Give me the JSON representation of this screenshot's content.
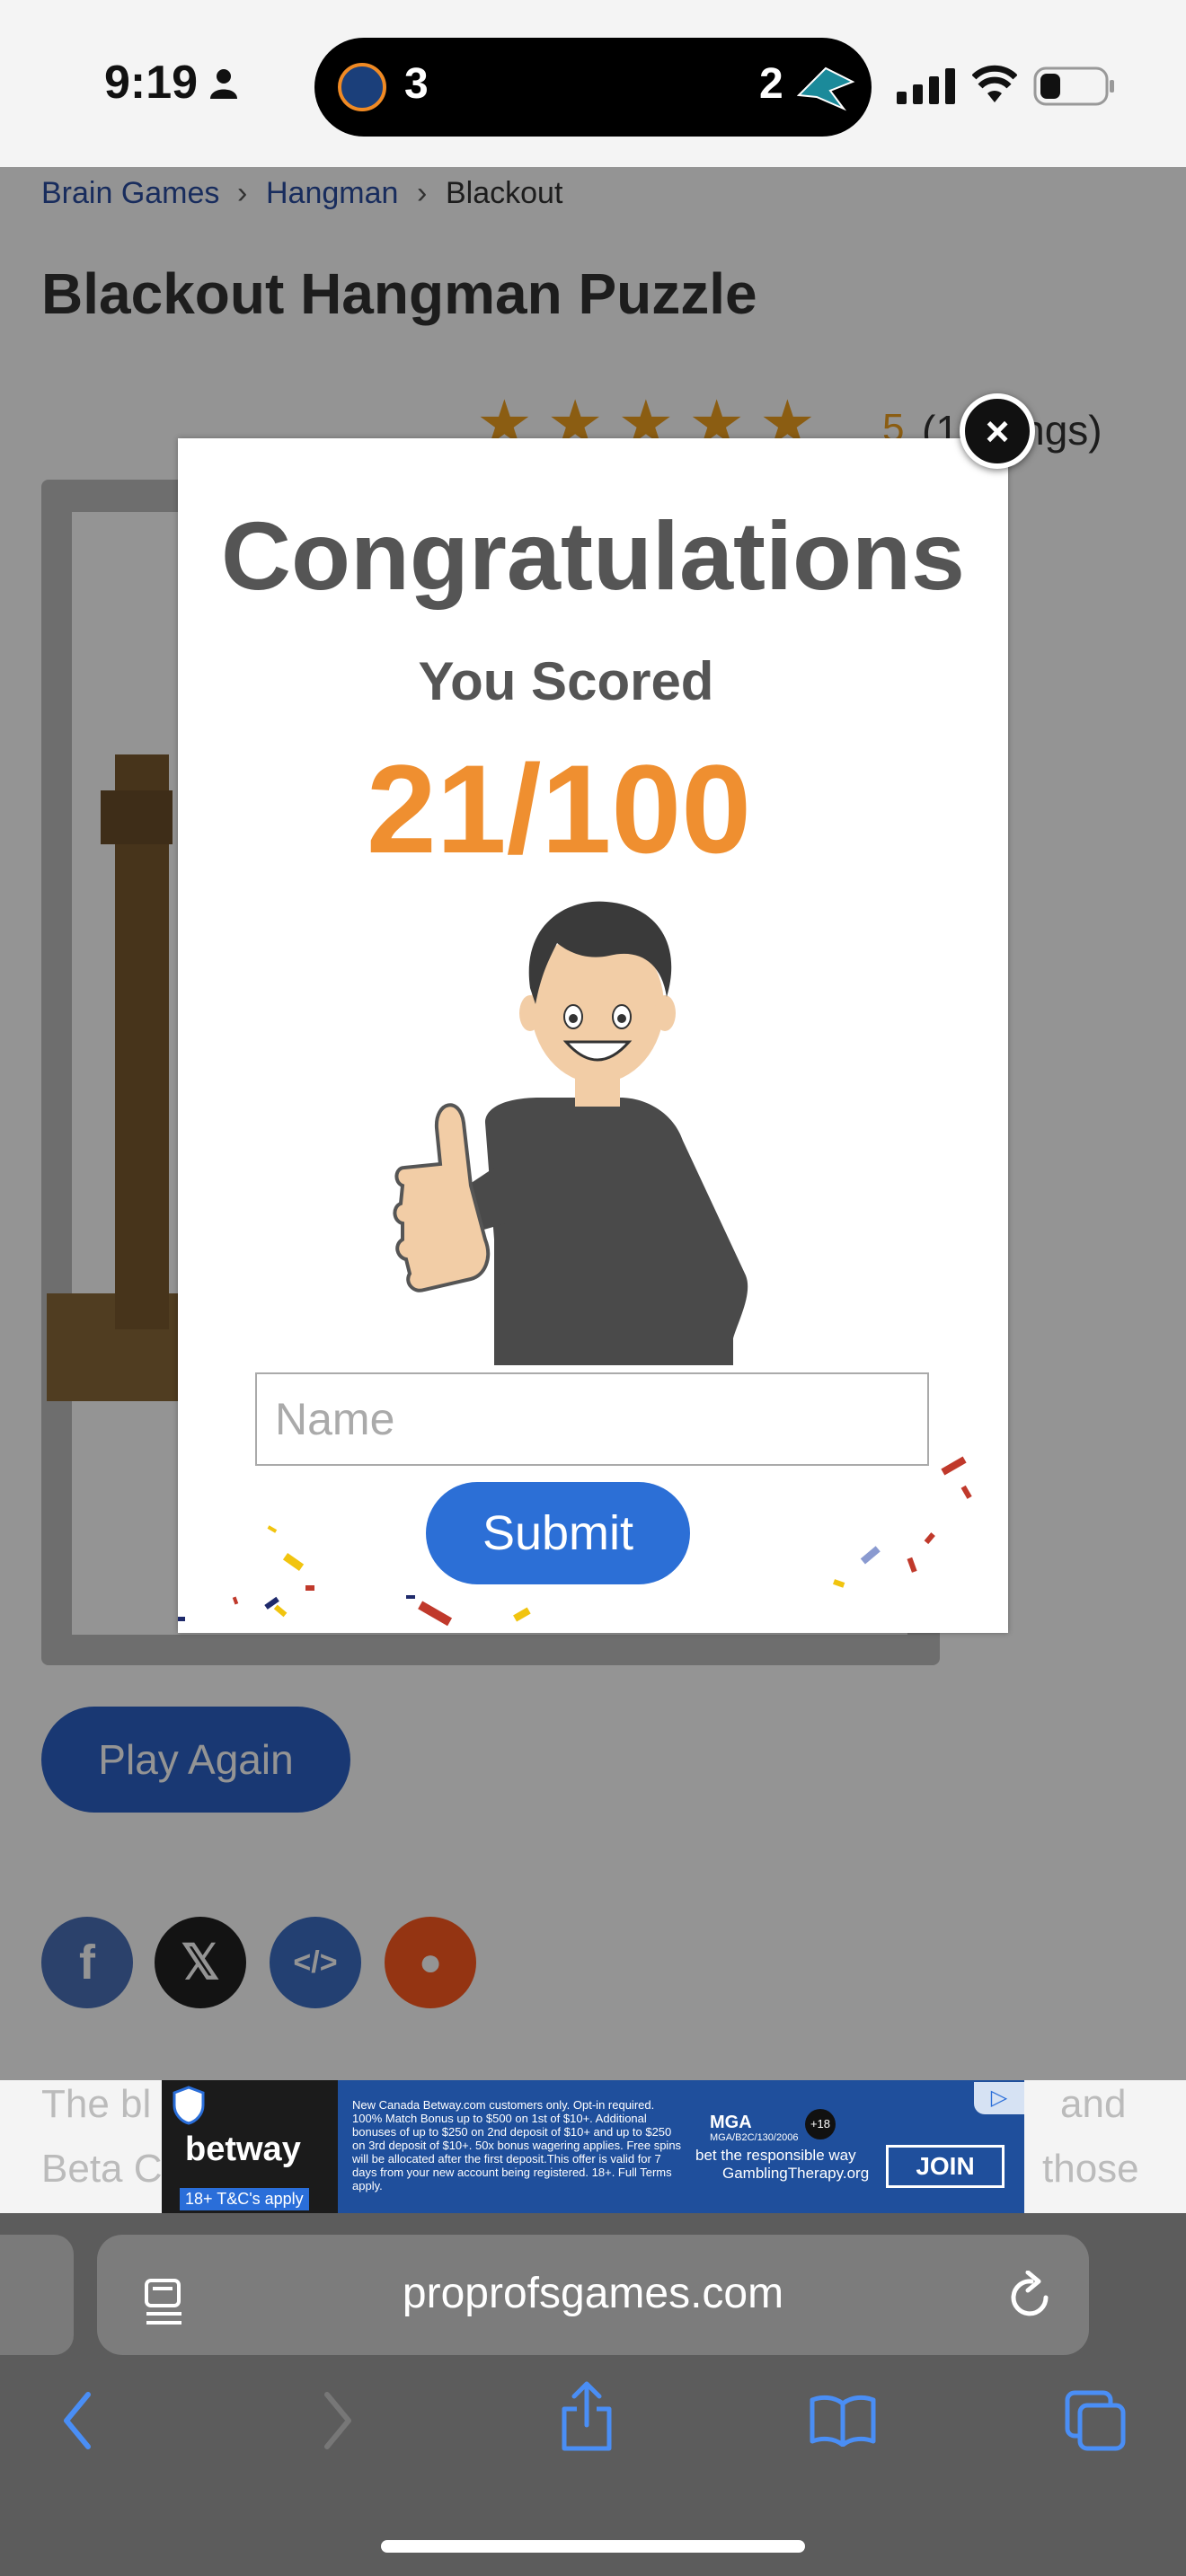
{
  "status_bar": {
    "time": "9:19",
    "left_team_score": "3",
    "right_team_score": "2"
  },
  "breadcrumb": {
    "items": [
      "Brain Games",
      "Hangman",
      "Blackout"
    ],
    "separator": "›"
  },
  "page": {
    "title": "Blackout Hangman Puzzle",
    "rating_value": "5",
    "rating_count_visible": "(1",
    "rating_suffix_visible": "ings)",
    "play_again_label": "Play Again",
    "under_text_left_1": "The bl",
    "under_text_left_2": "Beta C",
    "under_text_right_1": "and",
    "under_text_right_2": "those"
  },
  "share": {
    "icons": [
      "facebook-icon",
      "x-icon",
      "embed-icon",
      "reddit-icon"
    ]
  },
  "modal": {
    "heading": "Congratulations",
    "subheading": "You Scored",
    "score": "21/100",
    "name_placeholder": "Name",
    "submit_label": "Submit",
    "close_symbol": "×"
  },
  "ad": {
    "brand": "betway",
    "tc": "18+ T&C's apply",
    "fine_print": "New Canada Betway.com customers only. Opt-in required. 100% Match Bonus up to $500 on 1st of $10+. Additional bonuses of up to $250 on 2nd deposit of $10+ and up to $250 on 3rd deposit of $10+. 50x bonus wagering applies. Free spins will be allocated after the first deposit.This offer is valid for 7 days from your new account being registered. 18+. Full Terms apply.",
    "mga": "MGA",
    "mga_sub": "MGA/B2C/130/2006",
    "age_badge": "+18",
    "responsible": "bet the responsible way",
    "gambling_therapy": "GamblingTherapy.org",
    "join_label": "JOIN"
  },
  "browser": {
    "url": "proprofsgames.com"
  },
  "colors": {
    "score_orange": "#ef8f30",
    "button_blue": "#2c6fd6",
    "heading_gray": "#555555"
  }
}
